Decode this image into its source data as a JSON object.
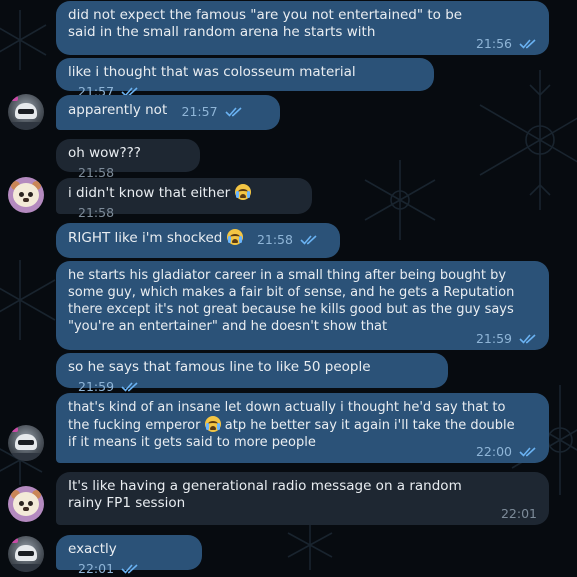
{
  "messages": [
    {
      "id": 1,
      "direction": "out",
      "text": "did not expect the famous \"are you not entertained\" to be said in the small random arena he starts with",
      "time": "21:56",
      "read": true
    },
    {
      "id": 2,
      "direction": "out",
      "text": "like i thought that was colosseum material",
      "time": "21:57",
      "read": true
    },
    {
      "id": 3,
      "direction": "out",
      "text": "apparently not",
      "time": "21:57",
      "read": true
    },
    {
      "id": 4,
      "direction": "in",
      "text": "oh wow???",
      "time": "21:58"
    },
    {
      "id": 5,
      "direction": "in",
      "text": "i didn't know that either",
      "emoji": "loudly-crying-face",
      "time": "21:58"
    },
    {
      "id": 6,
      "direction": "out",
      "text": "RIGHT like i'm shocked",
      "emoji": "loudly-crying-face",
      "time": "21:58",
      "read": true
    },
    {
      "id": 7,
      "direction": "out",
      "lines": [
        "he starts his gladiator career in a small thing after being bought by",
        "some guy, which makes a fair bit of sense, and he gets a Reputation",
        "there except it's not great because he kills good but as the guy says",
        "\"you're an entertainer\" and he doesn't show that"
      ],
      "time": "21:59",
      "read": true
    },
    {
      "id": 8,
      "direction": "out",
      "text": "so he says that famous line to like 50 people",
      "time": "21:59",
      "read": true
    },
    {
      "id": 9,
      "direction": "out",
      "text_before_emoji": "that's kind of an insane let down actually i thought he'd say that to the fucking emperor",
      "emoji": "loudly-crying-face",
      "text_after_emoji": "atp he better say it again i'll take the double if it means it gets said to more people",
      "time": "22:00",
      "read": true
    },
    {
      "id": 10,
      "direction": "in",
      "text": "It's like having a generational radio message on a random rainy FP1 session",
      "time": "22:01"
    },
    {
      "id": 11,
      "direction": "out",
      "text": "exactly",
      "time": "22:01",
      "read": true
    }
  ],
  "colors": {
    "background": "#070b10",
    "outgoing_bubble": "#2b5278",
    "incoming_bubble": "#1e2732",
    "read_check": "#6ab2f2"
  },
  "avatars": [
    {
      "name": "racer-avatar",
      "icon": "racing-helmet"
    },
    {
      "name": "bear-avatar",
      "icon": "bear-face"
    }
  ]
}
